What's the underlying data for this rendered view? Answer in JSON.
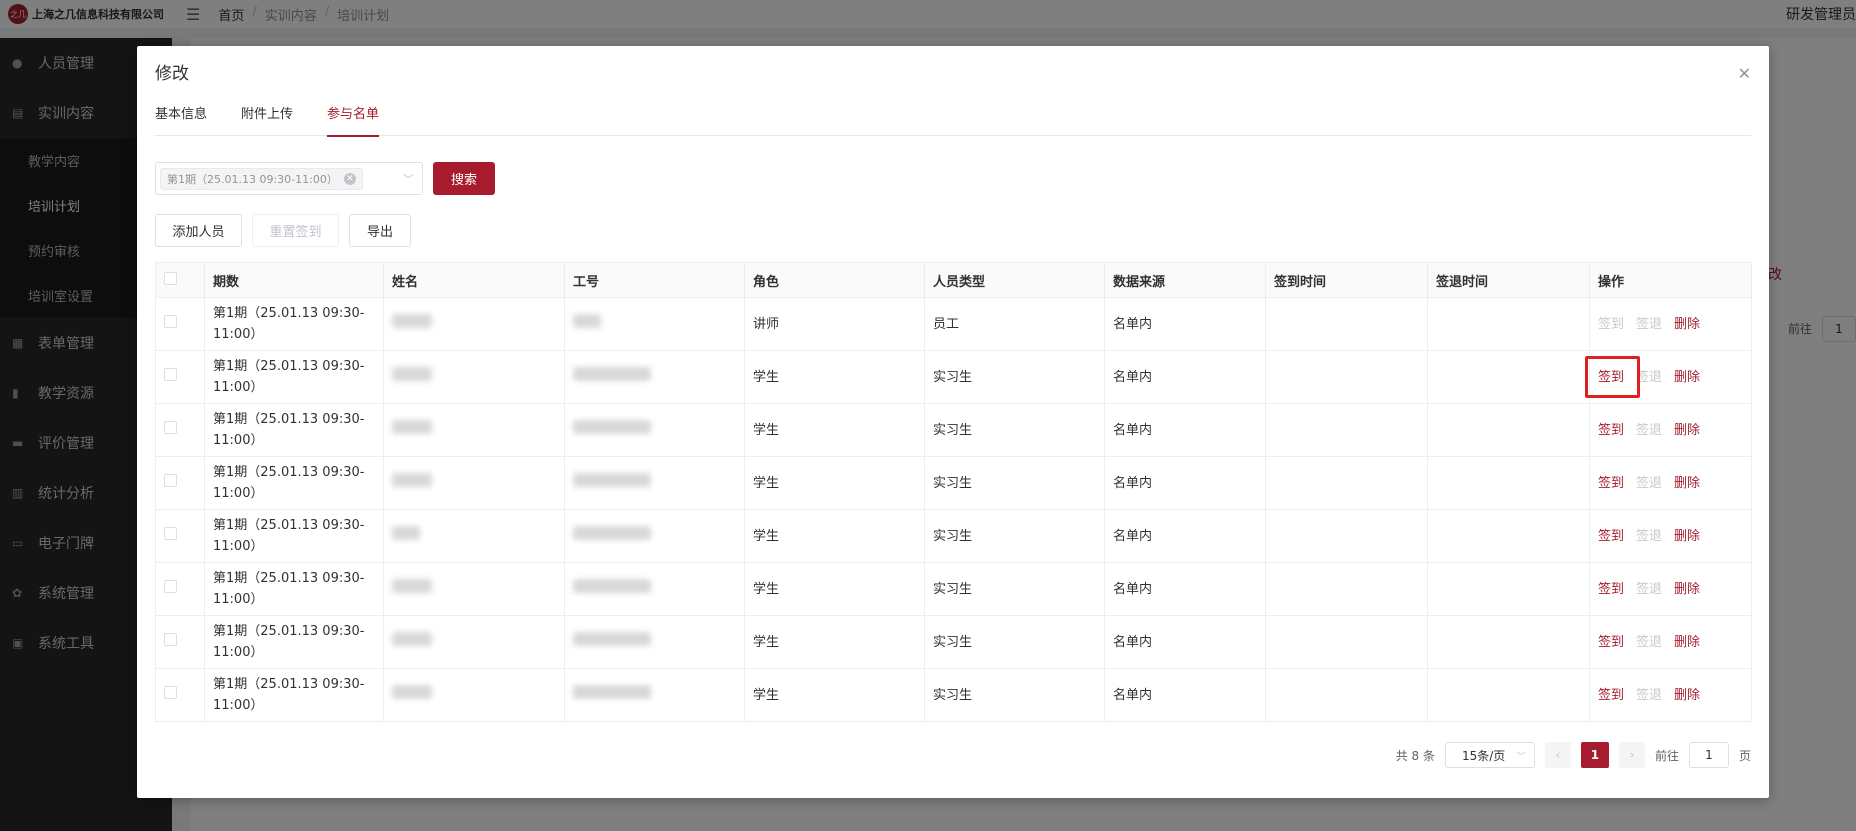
{
  "header": {
    "company": "上海之几信息科技有限公司",
    "logo_text": "之几",
    "menu_icon": "menu-fold-icon",
    "breadcrumb": [
      "首页",
      "实训内容",
      "培训计划"
    ],
    "user": "研发管理员"
  },
  "sidebar": {
    "items": [
      {
        "label": "人员管理",
        "icon": "user-icon"
      },
      {
        "label": "实训内容",
        "icon": "book-icon"
      },
      {
        "label": "表单管理",
        "icon": "form-icon"
      },
      {
        "label": "教学资源",
        "icon": "resource-icon"
      },
      {
        "label": "评价管理",
        "icon": "evaluation-icon"
      },
      {
        "label": "统计分析",
        "icon": "chart-icon"
      },
      {
        "label": "电子门牌",
        "icon": "monitor-icon"
      },
      {
        "label": "系统管理",
        "icon": "gear-icon"
      },
      {
        "label": "系统工具",
        "icon": "toolbox-icon"
      }
    ],
    "sub_items": [
      "教学内容",
      "培训计划",
      "预约审核",
      "培训室设置"
    ],
    "active_sub": "培训计划"
  },
  "background": {
    "edit_link_fragment": "改",
    "goto_label": "前往",
    "goto_value": "1"
  },
  "dialog": {
    "title": "修改",
    "tabs": [
      "基本信息",
      "附件上传",
      "参与名单"
    ],
    "active_tab": "参与名单",
    "filter": {
      "tag": "第1期（25.01.13 09:30-11:00）",
      "search_label": "搜索"
    },
    "toolbar": {
      "add": "添加人员",
      "reset": "重置签到",
      "export": "导出"
    },
    "table": {
      "columns": [
        "期数",
        "姓名",
        "工号",
        "角色",
        "人员类型",
        "数据来源",
        "签到时间",
        "签退时间",
        "操作"
      ],
      "rows": [
        {
          "period": "第1期（25.01.13 09:30-11:00）",
          "role": "讲师",
          "type": "员工",
          "source": "名单内",
          "checkin": "签到",
          "checkout": "签退",
          "delete": "删除",
          "checkin_enabled": false
        },
        {
          "period": "第1期（25.01.13 09:30-11:00）",
          "role": "学生",
          "type": "实习生",
          "source": "名单内",
          "checkin": "签到",
          "checkout": "签退",
          "delete": "删除",
          "checkin_enabled": true
        },
        {
          "period": "第1期（25.01.13 09:30-11:00）",
          "role": "学生",
          "type": "实习生",
          "source": "名单内",
          "checkin": "签到",
          "checkout": "签退",
          "delete": "删除",
          "checkin_enabled": true
        },
        {
          "period": "第1期（25.01.13 09:30-11:00）",
          "role": "学生",
          "type": "实习生",
          "source": "名单内",
          "checkin": "签到",
          "checkout": "签退",
          "delete": "删除",
          "checkin_enabled": true
        },
        {
          "period": "第1期（25.01.13 09:30-11:00）",
          "role": "学生",
          "type": "实习生",
          "source": "名单内",
          "checkin": "签到",
          "checkout": "签退",
          "delete": "删除",
          "checkin_enabled": true
        },
        {
          "period": "第1期（25.01.13 09:30-11:00）",
          "role": "学生",
          "type": "实习生",
          "source": "名单内",
          "checkin": "签到",
          "checkout": "签退",
          "delete": "删除",
          "checkin_enabled": true
        },
        {
          "period": "第1期（25.01.13 09:30-11:00）",
          "role": "学生",
          "type": "实习生",
          "source": "名单内",
          "checkin": "签到",
          "checkout": "签退",
          "delete": "删除",
          "checkin_enabled": true
        },
        {
          "period": "第1期（25.01.13 09:30-11:00）",
          "role": "学生",
          "type": "实习生",
          "source": "名单内",
          "checkin": "签到",
          "checkout": "签退",
          "delete": "删除",
          "checkin_enabled": true
        }
      ]
    },
    "pagination": {
      "total": "共 8 条",
      "page_size": "15条/页",
      "current_page": "1",
      "goto_label": "前往",
      "goto_value": "1",
      "page_suffix": "页"
    }
  },
  "colors": {
    "primary": "#a61c2e",
    "sidebar_bg": "#282828",
    "highlight": "#e02020"
  }
}
